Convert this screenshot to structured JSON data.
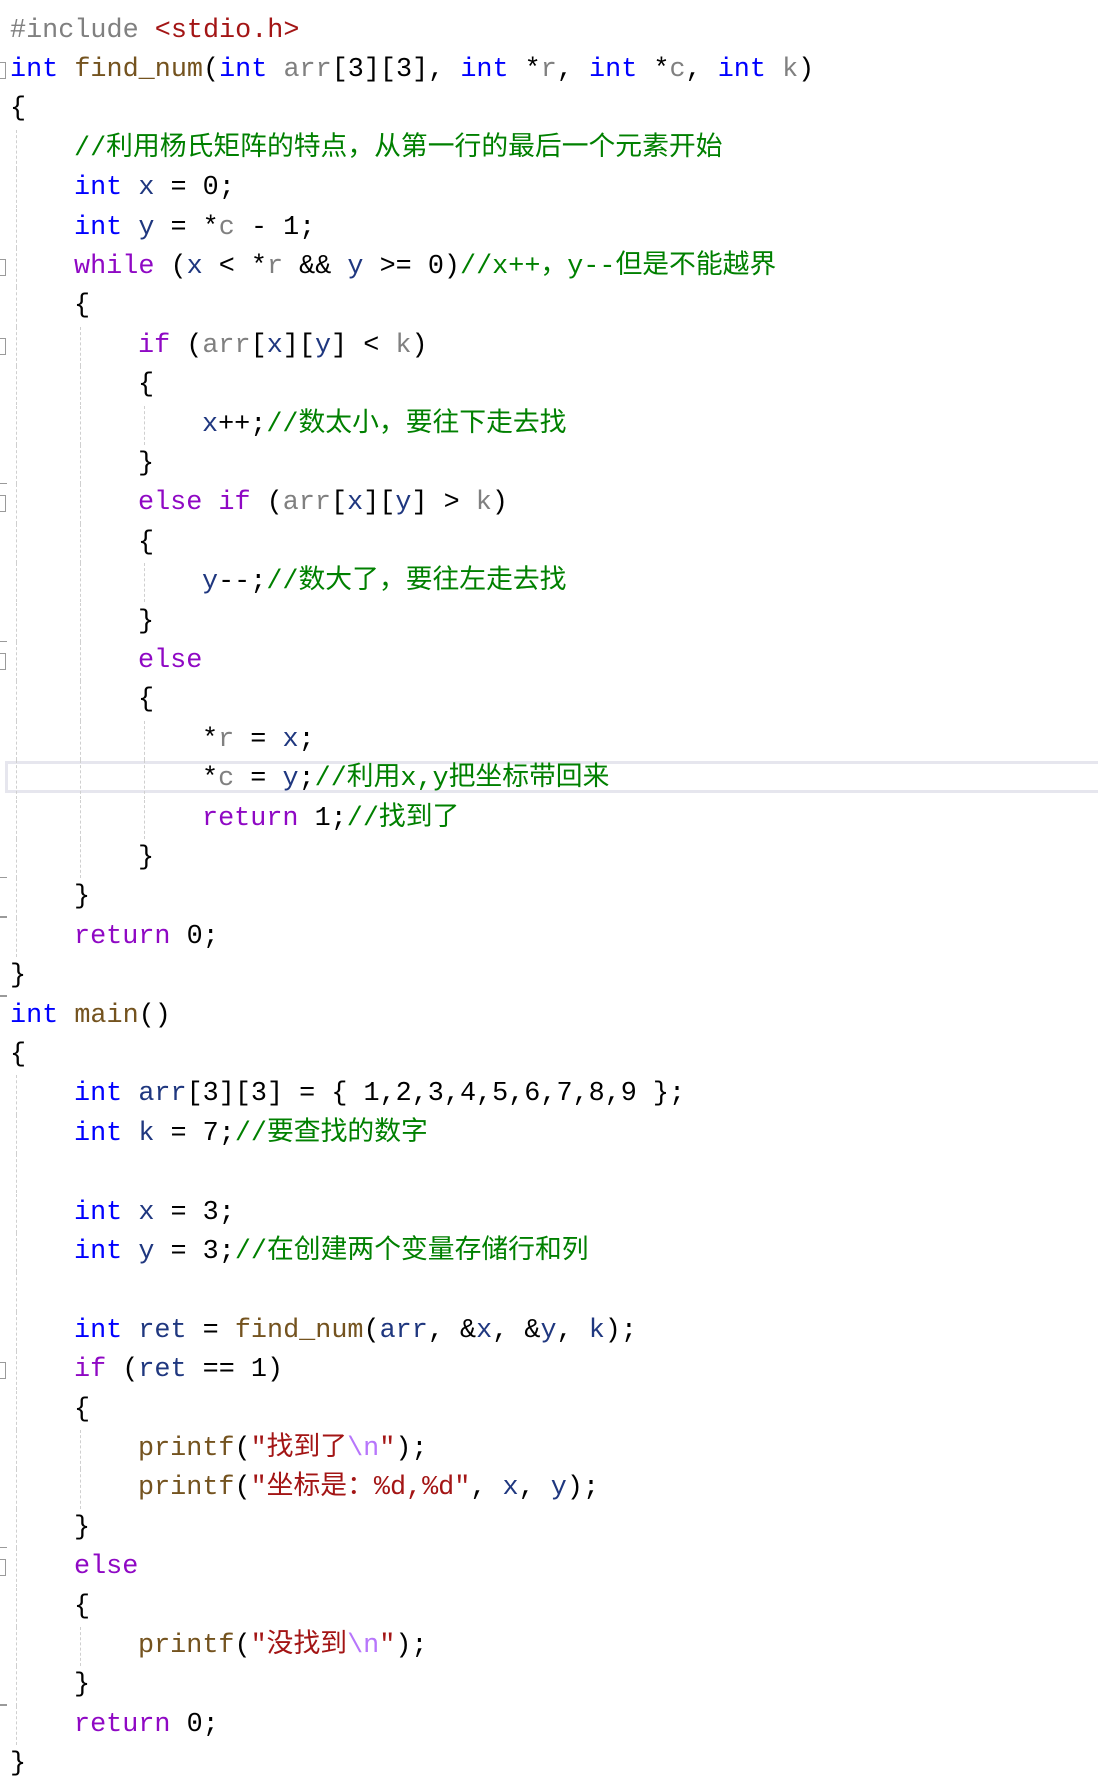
{
  "editor": {
    "language": "C",
    "current_line": 20,
    "colors": {
      "keyword": "#0000ff",
      "control": "#8f08c4",
      "function": "#74531f",
      "parameter": "#808080",
      "local": "#1f377f",
      "comment": "#008000",
      "string": "#a31515",
      "escape": "#b776fb",
      "highlight_border": "#e6e6ee"
    },
    "lines": [
      {
        "n": 1,
        "indent": 0,
        "fold": false,
        "tokens": [
          [
            "pp",
            "#include "
          ],
          [
            "inc",
            "<stdio.h>"
          ]
        ]
      },
      {
        "n": 2,
        "indent": 0,
        "fold": true,
        "tokens": [
          [
            "kw",
            "int"
          ],
          [
            "pun",
            " "
          ],
          [
            "fn",
            "find_num"
          ],
          [
            "pun",
            "("
          ],
          [
            "kw",
            "int"
          ],
          [
            "pun",
            " "
          ],
          [
            "param",
            "arr"
          ],
          [
            "pun",
            "[3][3], "
          ],
          [
            "kw",
            "int"
          ],
          [
            "pun",
            " *"
          ],
          [
            "param",
            "r"
          ],
          [
            "pun",
            ", "
          ],
          [
            "kw",
            "int"
          ],
          [
            "pun",
            " *"
          ],
          [
            "param",
            "c"
          ],
          [
            "pun",
            ", "
          ],
          [
            "kw",
            "int"
          ],
          [
            "pun",
            " "
          ],
          [
            "param",
            "k"
          ],
          [
            "pun",
            ")"
          ]
        ]
      },
      {
        "n": 3,
        "indent": 0,
        "fold": false,
        "tokens": [
          [
            "brace",
            "{"
          ]
        ]
      },
      {
        "n": 4,
        "indent": 1,
        "fold": false,
        "tokens": [
          [
            "cmt",
            "//利用杨氏矩阵的特点，从第一行的最后一个元素开始"
          ]
        ]
      },
      {
        "n": 5,
        "indent": 1,
        "fold": false,
        "tokens": [
          [
            "kw",
            "int"
          ],
          [
            "pun",
            " "
          ],
          [
            "var",
            "x"
          ],
          [
            "pun",
            " = 0;"
          ]
        ]
      },
      {
        "n": 6,
        "indent": 1,
        "fold": false,
        "tokens": [
          [
            "kw",
            "int"
          ],
          [
            "pun",
            " "
          ],
          [
            "var",
            "y"
          ],
          [
            "pun",
            " = *"
          ],
          [
            "param",
            "c"
          ],
          [
            "pun",
            " - 1;"
          ]
        ]
      },
      {
        "n": 7,
        "indent": 1,
        "fold": true,
        "tokens": [
          [
            "ctl",
            "while"
          ],
          [
            "pun",
            " ("
          ],
          [
            "var",
            "x"
          ],
          [
            "pun",
            " < *"
          ],
          [
            "param",
            "r"
          ],
          [
            "pun",
            " && "
          ],
          [
            "var",
            "y"
          ],
          [
            "pun",
            " >= 0)"
          ],
          [
            "cmt",
            "//x++，y--但是不能越界"
          ]
        ]
      },
      {
        "n": 8,
        "indent": 1,
        "fold": false,
        "tokens": [
          [
            "brace",
            "{"
          ]
        ]
      },
      {
        "n": 9,
        "indent": 2,
        "fold": true,
        "tokens": [
          [
            "ctl",
            "if"
          ],
          [
            "pun",
            " ("
          ],
          [
            "param",
            "arr"
          ],
          [
            "pun",
            "["
          ],
          [
            "var",
            "x"
          ],
          [
            "pun",
            "]["
          ],
          [
            "var",
            "y"
          ],
          [
            "pun",
            "] < "
          ],
          [
            "param",
            "k"
          ],
          [
            "pun",
            ")"
          ]
        ]
      },
      {
        "n": 10,
        "indent": 2,
        "fold": false,
        "tokens": [
          [
            "brace",
            "{"
          ]
        ]
      },
      {
        "n": 11,
        "indent": 3,
        "fold": false,
        "tokens": [
          [
            "var",
            "x"
          ],
          [
            "pun",
            "++;"
          ],
          [
            "cmt",
            "//数太小，要往下走去找"
          ]
        ]
      },
      {
        "n": 12,
        "indent": 2,
        "fold": false,
        "end": true,
        "tokens": [
          [
            "brace",
            "}"
          ]
        ]
      },
      {
        "n": 13,
        "indent": 2,
        "fold": true,
        "tokens": [
          [
            "ctl",
            "else if"
          ],
          [
            "pun",
            " ("
          ],
          [
            "param",
            "arr"
          ],
          [
            "pun",
            "["
          ],
          [
            "var",
            "x"
          ],
          [
            "pun",
            "]["
          ],
          [
            "var",
            "y"
          ],
          [
            "pun",
            "] > "
          ],
          [
            "param",
            "k"
          ],
          [
            "pun",
            ")"
          ]
        ]
      },
      {
        "n": 14,
        "indent": 2,
        "fold": false,
        "tokens": [
          [
            "brace",
            "{"
          ]
        ]
      },
      {
        "n": 15,
        "indent": 3,
        "fold": false,
        "tokens": [
          [
            "var",
            "y"
          ],
          [
            "pun",
            "--;"
          ],
          [
            "cmt",
            "//数大了，要往左走去找"
          ]
        ]
      },
      {
        "n": 16,
        "indent": 2,
        "fold": false,
        "end": true,
        "tokens": [
          [
            "brace",
            "}"
          ]
        ]
      },
      {
        "n": 17,
        "indent": 2,
        "fold": true,
        "tokens": [
          [
            "ctl",
            "else"
          ]
        ]
      },
      {
        "n": 18,
        "indent": 2,
        "fold": false,
        "tokens": [
          [
            "brace",
            "{"
          ]
        ]
      },
      {
        "n": 19,
        "indent": 3,
        "fold": false,
        "tokens": [
          [
            "pun",
            "*"
          ],
          [
            "param",
            "r"
          ],
          [
            "pun",
            " = "
          ],
          [
            "var",
            "x"
          ],
          [
            "pun",
            ";"
          ]
        ]
      },
      {
        "n": 20,
        "indent": 3,
        "fold": false,
        "tokens": [
          [
            "pun",
            "*"
          ],
          [
            "param",
            "c"
          ],
          [
            "pun",
            " = "
          ],
          [
            "var",
            "y"
          ],
          [
            "pun",
            ";"
          ],
          [
            "cmt",
            "//利用x,y把坐标带回来"
          ]
        ]
      },
      {
        "n": 21,
        "indent": 3,
        "fold": false,
        "tokens": [
          [
            "ctl",
            "return"
          ],
          [
            "pun",
            " 1;"
          ],
          [
            "cmt",
            "//找到了"
          ]
        ]
      },
      {
        "n": 22,
        "indent": 2,
        "fold": false,
        "end": true,
        "tokens": [
          [
            "brace",
            "}"
          ]
        ]
      },
      {
        "n": 23,
        "indent": 1,
        "fold": false,
        "end": true,
        "tokens": [
          [
            "brace",
            "}"
          ]
        ]
      },
      {
        "n": 24,
        "indent": 1,
        "fold": false,
        "tokens": [
          [
            "ctl",
            "return"
          ],
          [
            "pun",
            " 0;"
          ]
        ]
      },
      {
        "n": 25,
        "indent": 0,
        "fold": false,
        "end": true,
        "tokens": [
          [
            "brace",
            "}"
          ]
        ]
      },
      {
        "n": 26,
        "indent": 0,
        "fold": false,
        "tokens": [
          [
            "kw",
            "int"
          ],
          [
            "pun",
            " "
          ],
          [
            "fn",
            "main"
          ],
          [
            "pun",
            "()"
          ]
        ]
      },
      {
        "n": 27,
        "indent": 0,
        "fold": false,
        "tokens": [
          [
            "brace",
            "{"
          ]
        ]
      },
      {
        "n": 28,
        "indent": 1,
        "fold": false,
        "tokens": [
          [
            "kw",
            "int"
          ],
          [
            "pun",
            " "
          ],
          [
            "var",
            "arr"
          ],
          [
            "pun",
            "[3][3] = { 1,2,3,4,5,6,7,8,9 };"
          ]
        ]
      },
      {
        "n": 29,
        "indent": 1,
        "fold": false,
        "tokens": [
          [
            "kw",
            "int"
          ],
          [
            "pun",
            " "
          ],
          [
            "var",
            "k"
          ],
          [
            "pun",
            " = 7;"
          ],
          [
            "cmt",
            "//要查找的数字"
          ]
        ]
      },
      {
        "n": 30,
        "indent": 1,
        "fold": false,
        "tokens": []
      },
      {
        "n": 31,
        "indent": 1,
        "fold": false,
        "tokens": [
          [
            "kw",
            "int"
          ],
          [
            "pun",
            " "
          ],
          [
            "var",
            "x"
          ],
          [
            "pun",
            " = 3;"
          ]
        ]
      },
      {
        "n": 32,
        "indent": 1,
        "fold": false,
        "tokens": [
          [
            "kw",
            "int"
          ],
          [
            "pun",
            " "
          ],
          [
            "var",
            "y"
          ],
          [
            "pun",
            " = 3;"
          ],
          [
            "cmt",
            "//在创建两个变量存储行和列"
          ]
        ]
      },
      {
        "n": 33,
        "indent": 1,
        "fold": false,
        "tokens": []
      },
      {
        "n": 34,
        "indent": 1,
        "fold": false,
        "tokens": [
          [
            "kw",
            "int"
          ],
          [
            "pun",
            " "
          ],
          [
            "var",
            "ret"
          ],
          [
            "pun",
            " = "
          ],
          [
            "fn",
            "find_num"
          ],
          [
            "pun",
            "("
          ],
          [
            "var",
            "arr"
          ],
          [
            "pun",
            ", &"
          ],
          [
            "var",
            "x"
          ],
          [
            "pun",
            ", &"
          ],
          [
            "var",
            "y"
          ],
          [
            "pun",
            ", "
          ],
          [
            "var",
            "k"
          ],
          [
            "pun",
            ");"
          ]
        ]
      },
      {
        "n": 35,
        "indent": 1,
        "fold": true,
        "tokens": [
          [
            "ctl",
            "if"
          ],
          [
            "pun",
            " ("
          ],
          [
            "var",
            "ret"
          ],
          [
            "pun",
            " == 1)"
          ]
        ]
      },
      {
        "n": 36,
        "indent": 1,
        "fold": false,
        "tokens": [
          [
            "brace",
            "{"
          ]
        ]
      },
      {
        "n": 37,
        "indent": 2,
        "fold": false,
        "tokens": [
          [
            "fn",
            "printf"
          ],
          [
            "pun",
            "("
          ],
          [
            "str",
            "\"找到了"
          ],
          [
            "esc",
            "\\n"
          ],
          [
            "str",
            "\""
          ],
          [
            "pun",
            ");"
          ]
        ]
      },
      {
        "n": 38,
        "indent": 2,
        "fold": false,
        "tokens": [
          [
            "fn",
            "printf"
          ],
          [
            "pun",
            "("
          ],
          [
            "str",
            "\"坐标是：%d,%d\""
          ],
          [
            "pun",
            ", "
          ],
          [
            "var",
            "x"
          ],
          [
            "pun",
            ", "
          ],
          [
            "var",
            "y"
          ],
          [
            "pun",
            ");"
          ]
        ]
      },
      {
        "n": 39,
        "indent": 1,
        "fold": false,
        "end": true,
        "tokens": [
          [
            "brace",
            "}"
          ]
        ]
      },
      {
        "n": 40,
        "indent": 1,
        "fold": true,
        "tokens": [
          [
            "ctl",
            "else"
          ]
        ]
      },
      {
        "n": 41,
        "indent": 1,
        "fold": false,
        "tokens": [
          [
            "brace",
            "{"
          ]
        ]
      },
      {
        "n": 42,
        "indent": 2,
        "fold": false,
        "tokens": [
          [
            "fn",
            "printf"
          ],
          [
            "pun",
            "("
          ],
          [
            "str",
            "\"没找到"
          ],
          [
            "esc",
            "\\n"
          ],
          [
            "str",
            "\""
          ],
          [
            "pun",
            ");"
          ]
        ]
      },
      {
        "n": 43,
        "indent": 1,
        "fold": false,
        "end": true,
        "tokens": [
          [
            "brace",
            "}"
          ]
        ]
      },
      {
        "n": 44,
        "indent": 1,
        "fold": false,
        "tokens": [
          [
            "ctl",
            "return"
          ],
          [
            "pun",
            " 0;"
          ]
        ]
      },
      {
        "n": 45,
        "indent": 0,
        "fold": false,
        "tokens": [
          [
            "brace",
            "}"
          ]
        ]
      }
    ]
  }
}
